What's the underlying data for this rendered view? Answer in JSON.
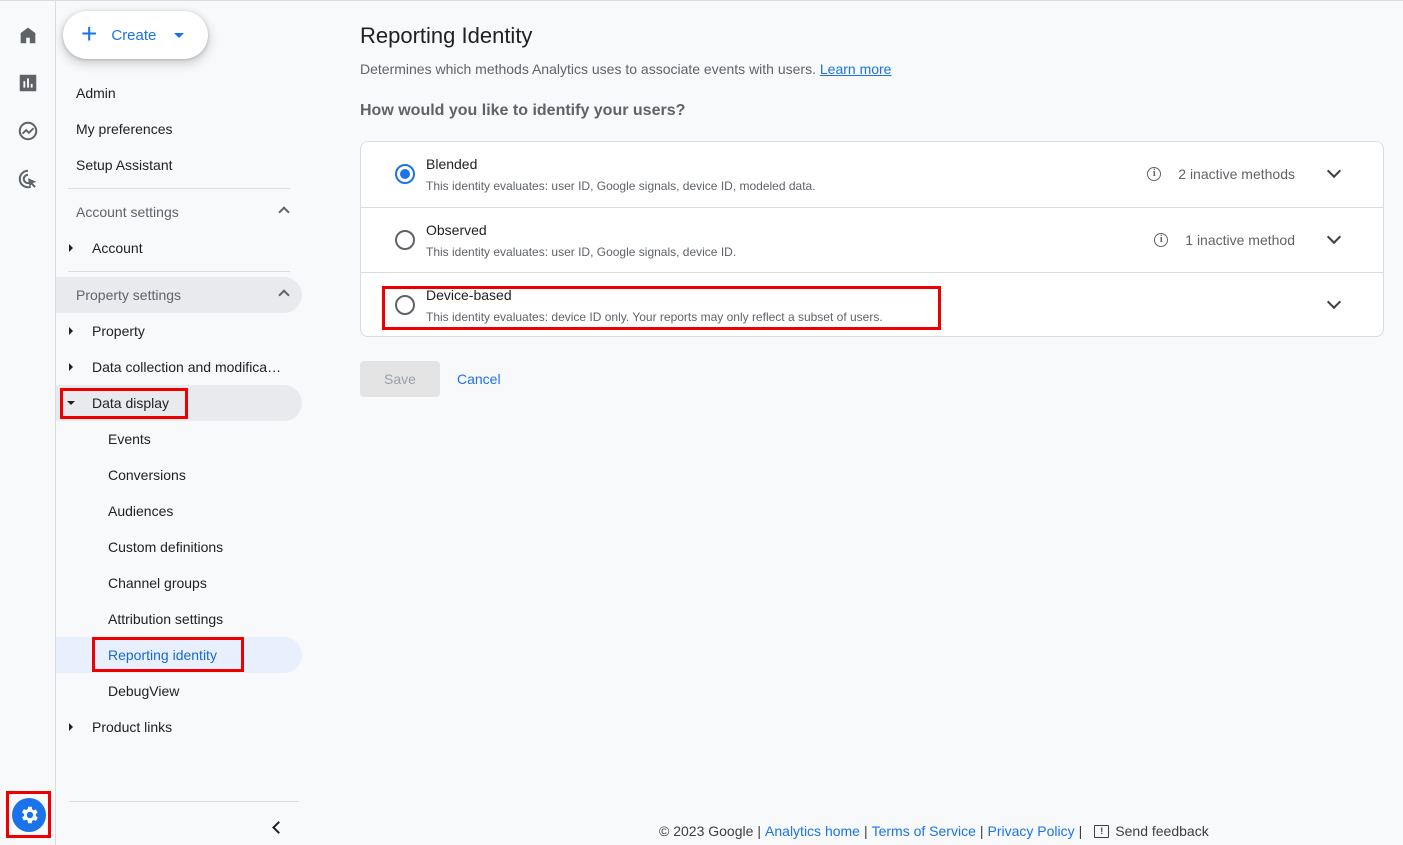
{
  "rail": {
    "items": [
      {
        "name": "home",
        "icon": "home-icon"
      },
      {
        "name": "reports",
        "icon": "bar-chart-icon"
      },
      {
        "name": "explore",
        "icon": "explore-trend-icon"
      },
      {
        "name": "advertising",
        "icon": "target-cursor-icon"
      }
    ],
    "admin_icon": "gear-icon"
  },
  "nav": {
    "create_label": "Create",
    "top_items": [
      "Admin",
      "My preferences",
      "Setup Assistant"
    ],
    "account_section": {
      "label": "Account settings",
      "items": [
        "Account"
      ]
    },
    "property_section": {
      "label": "Property settings",
      "items": [
        "Property",
        "Data collection and modifica…",
        "Data display"
      ],
      "data_display_children": [
        "Events",
        "Conversions",
        "Audiences",
        "Custom definitions",
        "Channel groups",
        "Attribution settings",
        "Reporting identity",
        "DebugView"
      ],
      "after_items": [
        "Product links"
      ]
    },
    "active_item": "Reporting identity"
  },
  "main": {
    "title": "Reporting Identity",
    "description": "Determines which methods Analytics uses to associate events with users.",
    "learn_more": "Learn more",
    "question": "How would you like to identify your users?",
    "options": [
      {
        "title": "Blended",
        "description": "This identity evaluates: user ID, Google signals, device ID, modeled data.",
        "meta": "2 inactive methods",
        "selected": true
      },
      {
        "title": "Observed",
        "description": "This identity evaluates: user ID, Google signals, device ID.",
        "meta": "1 inactive method",
        "selected": false
      },
      {
        "title": "Device-based",
        "description": "This identity evaluates: device ID only. Your reports may only reflect a subset of users.",
        "meta": "",
        "selected": false
      }
    ],
    "save_label": "Save",
    "cancel_label": "Cancel"
  },
  "footer": {
    "copyright": "© 2023 Google",
    "links": [
      "Analytics home",
      "Terms of Service",
      "Privacy Policy"
    ],
    "feedback": "Send feedback"
  },
  "colors": {
    "accent": "#1a73e8",
    "highlight_box": "#ee0000",
    "active_nav_bg": "#e8f0fe"
  }
}
